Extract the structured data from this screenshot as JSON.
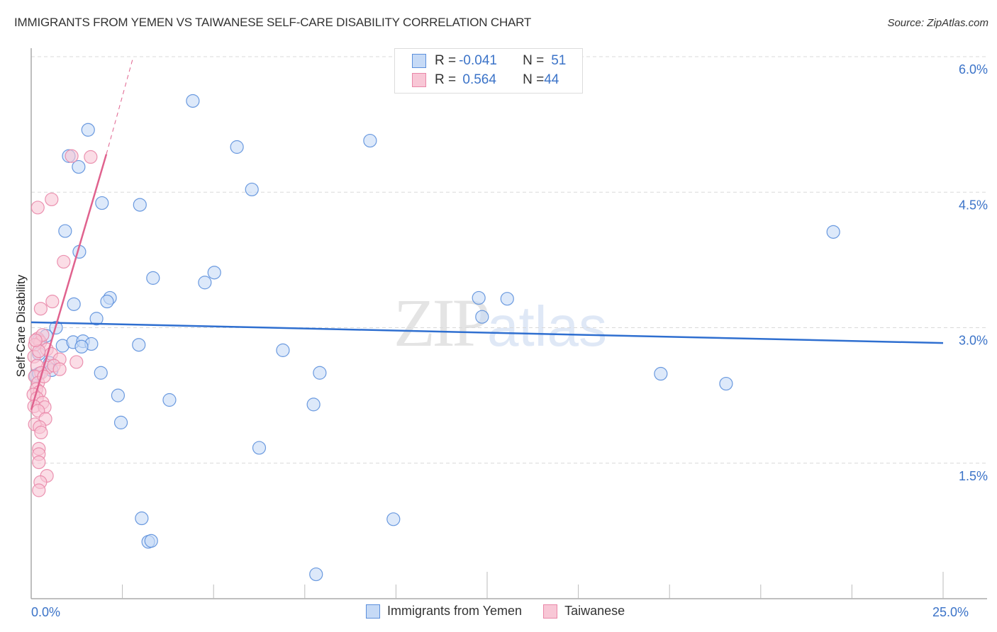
{
  "title": "IMMIGRANTS FROM YEMEN VS TAIWANESE SELF-CARE DISABILITY CORRELATION CHART",
  "source": "Source: ZipAtlas.com",
  "watermark": {
    "zip": "ZIP",
    "atlas": "atlas"
  },
  "colors": {
    "blue_fill": "#c6daf6",
    "blue_stroke": "#5b8fdc",
    "blue_line": "#2f6fd0",
    "pink_fill": "#f8c7d6",
    "pink_stroke": "#e987a8",
    "pink_line": "#e0628e",
    "tick_label": "#3b73c8",
    "grid": "#d9d9d9"
  },
  "legend_top": {
    "rows": [
      {
        "r_label": "R = ",
        "r_value": "-0.041",
        "n_label": "N = ",
        "n_value": "51"
      },
      {
        "r_label": "R = ",
        "r_value": " 0.564",
        "n_label": "N = ",
        "n_value": "44"
      }
    ]
  },
  "legend_bottom": [
    "Immigrants from Yemen",
    "Taiwanese"
  ],
  "chart_data": {
    "type": "scatter",
    "title": "IMMIGRANTS FROM YEMEN VS TAIWANESE SELF-CARE DISABILITY CORRELATION CHART",
    "xlabel": "",
    "ylabel": "Self-Care Disability",
    "xlim": [
      0,
      25
    ],
    "ylim": [
      0,
      6.0
    ],
    "x_tick_labels": [
      {
        "value": 0,
        "label": "0.0%"
      },
      {
        "value": 25,
        "label": "25.0%"
      }
    ],
    "x_minor_ticks": [
      2.5,
      5,
      7.5,
      10,
      12.5,
      15,
      17.5,
      20,
      22.5,
      25
    ],
    "y_ticks": [
      {
        "value": 1.5,
        "label": "1.5%"
      },
      {
        "value": 3.0,
        "label": "3.0%"
      },
      {
        "value": 4.5,
        "label": "4.5%"
      },
      {
        "value": 6.0,
        "label": "6.0%"
      }
    ],
    "grid": "horizontal dashed",
    "legend": "bottom-center",
    "series": [
      {
        "name": "Immigrants from Yemen",
        "R": -0.041,
        "N": 51,
        "trend": {
          "x": [
            0,
            25
          ],
          "y": [
            3.06,
            2.83
          ]
        },
        "points": [
          [
            4.43,
            5.51
          ],
          [
            1.56,
            5.19
          ],
          [
            1.03,
            4.9
          ],
          [
            1.3,
            4.78
          ],
          [
            5.64,
            5.0
          ],
          [
            9.29,
            5.07
          ],
          [
            6.05,
            4.53
          ],
          [
            1.94,
            4.38
          ],
          [
            2.98,
            4.36
          ],
          [
            0.93,
            4.07
          ],
          [
            21.99,
            4.06
          ],
          [
            1.32,
            3.84
          ],
          [
            5.02,
            3.61
          ],
          [
            3.34,
            3.55
          ],
          [
            4.76,
            3.5
          ],
          [
            2.16,
            3.33
          ],
          [
            2.08,
            3.29
          ],
          [
            12.27,
            3.33
          ],
          [
            13.05,
            3.32
          ],
          [
            1.17,
            3.26
          ],
          [
            12.36,
            3.12
          ],
          [
            1.79,
            3.1
          ],
          [
            0.68,
            3.0
          ],
          [
            0.41,
            2.91
          ],
          [
            0.21,
            2.86
          ],
          [
            0.86,
            2.8
          ],
          [
            1.15,
            2.84
          ],
          [
            1.42,
            2.85
          ],
          [
            1.65,
            2.82
          ],
          [
            1.38,
            2.79
          ],
          [
            2.95,
            2.81
          ],
          [
            6.9,
            2.75
          ],
          [
            0.21,
            2.71
          ],
          [
            0.51,
            2.61
          ],
          [
            0.56,
            2.53
          ],
          [
            1.91,
            2.5
          ],
          [
            7.91,
            2.5
          ],
          [
            17.26,
            2.49
          ],
          [
            19.05,
            2.38
          ],
          [
            0.12,
            2.47
          ],
          [
            0.21,
            2.49
          ],
          [
            2.38,
            2.25
          ],
          [
            3.79,
            2.2
          ],
          [
            7.74,
            2.15
          ],
          [
            2.46,
            1.95
          ],
          [
            6.25,
            1.67
          ],
          [
            3.03,
            0.89
          ],
          [
            3.21,
            0.63
          ],
          [
            3.29,
            0.64
          ],
          [
            9.93,
            0.88
          ],
          [
            7.81,
            0.27
          ]
        ]
      },
      {
        "name": "Taiwanese",
        "R": 0.564,
        "N": 44,
        "trend": {
          "x": [
            0,
            2.06
          ],
          "y": [
            2.09,
            4.92
          ],
          "dashed_to": {
            "x": 2.8,
            "y": 6.0
          }
        },
        "points": [
          [
            1.11,
            4.9
          ],
          [
            1.63,
            4.89
          ],
          [
            0.56,
            4.42
          ],
          [
            0.18,
            4.33
          ],
          [
            0.89,
            3.73
          ],
          [
            0.58,
            3.29
          ],
          [
            0.26,
            3.21
          ],
          [
            0.18,
            2.88
          ],
          [
            0.25,
            2.84
          ],
          [
            0.1,
            2.81
          ],
          [
            0.31,
            2.92
          ],
          [
            0.43,
            2.76
          ],
          [
            0.55,
            2.71
          ],
          [
            0.08,
            2.68
          ],
          [
            0.21,
            2.74
          ],
          [
            0.78,
            2.65
          ],
          [
            1.24,
            2.62
          ],
          [
            0.45,
            2.56
          ],
          [
            0.16,
            2.58
          ],
          [
            0.62,
            2.58
          ],
          [
            0.78,
            2.54
          ],
          [
            0.27,
            2.5
          ],
          [
            0.1,
            2.46
          ],
          [
            0.19,
            2.39
          ],
          [
            0.14,
            2.32
          ],
          [
            0.23,
            2.29
          ],
          [
            0.06,
            2.26
          ],
          [
            0.16,
            2.22
          ],
          [
            0.31,
            2.17
          ],
          [
            0.08,
            2.13
          ],
          [
            0.37,
            2.12
          ],
          [
            0.19,
            2.08
          ],
          [
            0.39,
            1.99
          ],
          [
            0.1,
            1.93
          ],
          [
            0.23,
            1.9
          ],
          [
            0.27,
            1.84
          ],
          [
            0.21,
            1.66
          ],
          [
            0.21,
            1.6
          ],
          [
            0.21,
            1.51
          ],
          [
            0.43,
            1.36
          ],
          [
            0.25,
            1.29
          ],
          [
            0.21,
            1.2
          ],
          [
            0.35,
            2.46
          ],
          [
            0.12,
            2.86
          ]
        ]
      }
    ]
  }
}
